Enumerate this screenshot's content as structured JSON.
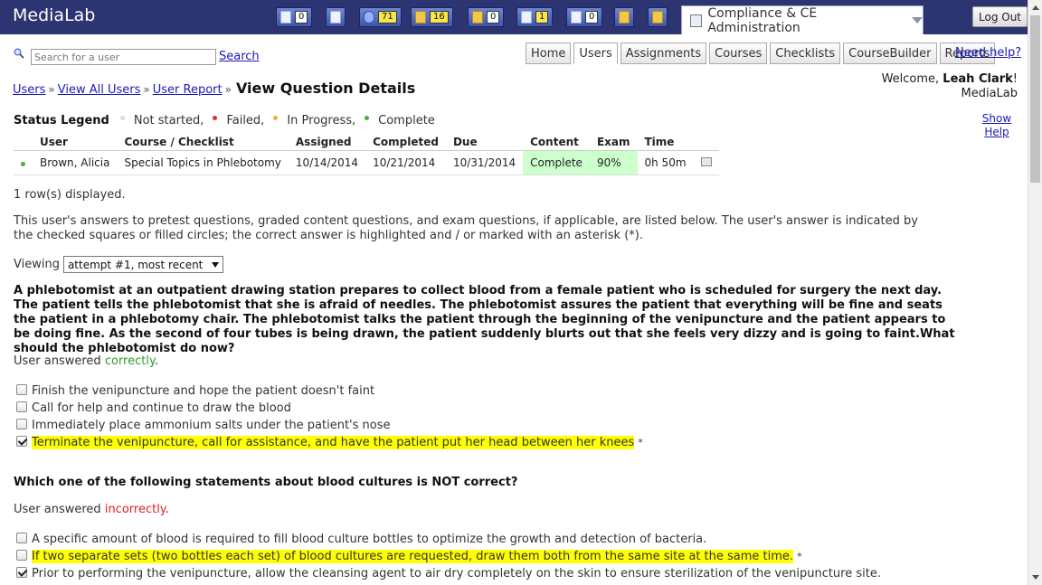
{
  "app": {
    "name": "MediaLab",
    "module": "Compliance & CE Administration",
    "logout": "Log Out"
  },
  "toolbar": [
    {
      "icon": "document-icon",
      "count": "0",
      "glyph": "w",
      "highlight": false
    },
    {
      "icon": "calculator-icon",
      "count": "",
      "glyph": "w",
      "highlight": false
    },
    {
      "icon": "globe-icon",
      "count": "71",
      "glyph": "b",
      "highlight": true
    },
    {
      "icon": "folder-icon",
      "count": "16",
      "glyph": "y",
      "highlight": true
    },
    {
      "icon": "shield-icon",
      "count": "0",
      "glyph": "y",
      "highlight": false
    },
    {
      "icon": "id-card-icon",
      "count": "1",
      "glyph": "w",
      "highlight": true
    },
    {
      "icon": "mail-icon",
      "count": "0",
      "glyph": "w",
      "highlight": false
    },
    {
      "icon": "tools-icon",
      "count": "",
      "glyph": "y",
      "highlight": false
    },
    {
      "icon": "notepad-icon",
      "count": "",
      "glyph": "y",
      "highlight": false
    }
  ],
  "search": {
    "placeholder": "Search for a user",
    "link": "Search"
  },
  "nav": {
    "items": [
      "Home",
      "Users",
      "Assignments",
      "Courses",
      "Checklists",
      "CourseBuilder",
      "Reports"
    ],
    "active": "Users",
    "help": "Need help?"
  },
  "breadcrumb": {
    "items": [
      "Users",
      "View All Users",
      "User Report"
    ],
    "separator": "»",
    "current": "View Question Details"
  },
  "welcome": {
    "prefix": "Welcome, ",
    "name": "Leah Clark",
    "suffix": "!",
    "org": "MediaLab"
  },
  "show_help": "Show Help",
  "legend": {
    "title": "Status Legend",
    "items": [
      {
        "label": "Not started,",
        "color": "#e6e6e6"
      },
      {
        "label": "Failed,",
        "color": "#e03030"
      },
      {
        "label": "In Progress,",
        "color": "#f0b030"
      },
      {
        "label": "Complete",
        "color": "#40b040"
      }
    ]
  },
  "status_table": {
    "headers": [
      "",
      "User",
      "Course / Checklist",
      "Assigned",
      "Completed",
      "Due",
      "Content",
      "Exam",
      "Time",
      ""
    ],
    "row": {
      "user": "Brown, Alicia",
      "course": "Special Topics in Phlebotomy",
      "assigned": "10/14/2014",
      "completed": "10/21/2014",
      "due": "10/31/2014",
      "content": "Complete",
      "exam": "90%",
      "time": "0h 50m",
      "status_color": "#40b040"
    }
  },
  "rows_displayed": "1 row(s) displayed.",
  "intro": "This user's answers to pretest questions, graded content questions, and exam questions, if applicable, are listed below. The user's answer is indicated by the checked squares or filled circles; the correct answer is highlighted and / or marked with an asterisk (*).",
  "viewing": {
    "label": "Viewing",
    "selected": "attempt #1, most recent"
  },
  "answered_prefix": "User answered ",
  "questions": [
    {
      "text": "A phlebotomist at an outpatient drawing station prepares to collect blood from a female patient who is scheduled for surgery the next day. The patient tells the phlebotomist that she is afraid of needles. The phlebotomist assures the patient that everything will be fine and seats the patient in a phlebotomy chair. The phlebotomist talks the patient through the beginning of the venipuncture and the patient appears to be doing fine. As the second of four tubes is being drawn, the patient suddenly blurts out that she feels very dizzy and is going to faint.What should the phlebotomist do now?",
      "result": "correctly",
      "answers": [
        {
          "text": "Finish the venipuncture and hope the patient doesn't faint",
          "checked": false,
          "correct": false
        },
        {
          "text": "Call for help and continue to draw the blood",
          "checked": false,
          "correct": false
        },
        {
          "text": "Immediately place ammonium salts under the patient's nose",
          "checked": false,
          "correct": false
        },
        {
          "text": "Terminate the venipuncture, call for assistance, and have the patient put her head between her knees",
          "checked": true,
          "correct": true
        }
      ]
    },
    {
      "text": "Which one of the following statements about blood cultures is NOT correct?",
      "result": "incorrectly",
      "answers": [
        {
          "text": "A specific amount of blood is required to fill blood culture bottles to optimize the growth and detection of bacteria.",
          "checked": false,
          "correct": false
        },
        {
          "text": "If two separate sets (two bottles each set) of blood cultures are requested, draw them both from the same site at the same time.",
          "checked": false,
          "correct": true
        },
        {
          "text": "Prior to performing the venipuncture, allow the cleansing agent to air dry completely on the skin to ensure sterilization of the venipuncture site.",
          "checked": true,
          "correct": false
        }
      ]
    }
  ],
  "asterisk": "*"
}
